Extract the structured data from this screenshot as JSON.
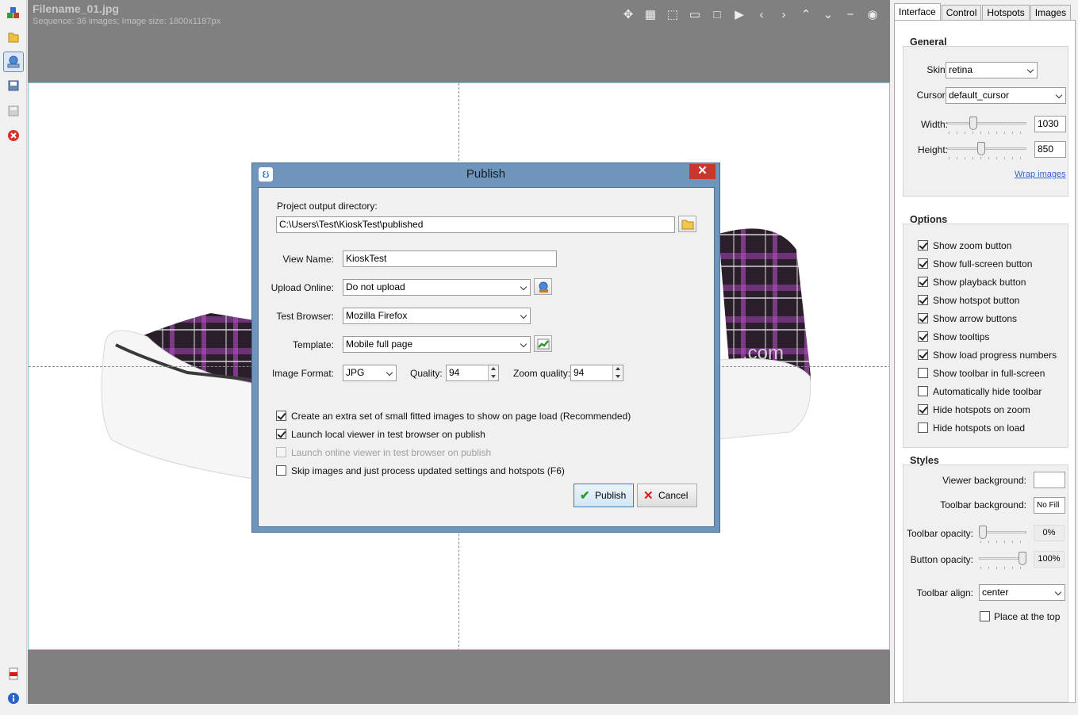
{
  "viewer": {
    "title": "Filename_01.jpg",
    "subtitle": "Sequence: 36 images; Image size: 1800x1187px",
    "watermark": ".com",
    "toolbar_icons": [
      "move-icon",
      "grid-icon",
      "select-icon",
      "fit-icon",
      "fullscreen-icon",
      "play-icon",
      "arrow-left-icon",
      "arrow-right-icon",
      "arrow-up-icon",
      "arrow-down-icon",
      "minus-icon",
      "target-icon"
    ]
  },
  "left_toolbar": {
    "icons": [
      "puzzle-icon",
      "folder-icon",
      "publish-icon",
      "save-image-icon",
      "save-icon",
      "close-red-icon",
      "pdf-icon",
      "info-icon"
    ]
  },
  "panel": {
    "tabs": [
      "Interface",
      "Control",
      "Hotspots",
      "Images"
    ],
    "general": {
      "title": "General",
      "skin_label": "Skin:",
      "skin_value": "retina",
      "cursor_label": "Cursor:",
      "cursor_value": "default_cursor",
      "width_label": "Width:",
      "width_value": "1030",
      "height_label": "Height:",
      "height_value": "850",
      "wrap_link": "Wrap images"
    },
    "options": {
      "title": "Options",
      "items": [
        {
          "label": "Show zoom button",
          "checked": true
        },
        {
          "label": "Show full-screen button",
          "checked": true
        },
        {
          "label": "Show playback button",
          "checked": true
        },
        {
          "label": "Show hotspot button",
          "checked": true
        },
        {
          "label": "Show arrow buttons",
          "checked": true
        },
        {
          "label": "Show tooltips",
          "checked": true
        },
        {
          "label": "Show load progress numbers",
          "checked": true
        },
        {
          "label": "Show toolbar in full-screen",
          "checked": false
        },
        {
          "label": "Automatically hide toolbar",
          "checked": false
        },
        {
          "label": "Hide hotspots on zoom",
          "checked": true
        },
        {
          "label": "Hide hotspots on load",
          "checked": false
        }
      ]
    },
    "styles": {
      "title": "Styles",
      "viewer_bg_label": "Viewer background:",
      "toolbar_bg_label": "Toolbar background:",
      "toolbar_bg_value": "No Fill",
      "toolbar_opacity_label": "Toolbar opacity:",
      "toolbar_opacity_value": "0%",
      "button_opacity_label": "Button opacity:",
      "button_opacity_value": "100%",
      "toolbar_align_label": "Toolbar align:",
      "toolbar_align_value": "center",
      "place_top_label": "Place at the top"
    }
  },
  "dialog": {
    "title": "Publish",
    "output_dir_label": "Project output directory:",
    "output_dir_value": "C:\\Users\\Test\\KioskTest\\published",
    "view_name_label": "View Name:",
    "view_name_value": "KioskTest",
    "upload_label": "Upload Online:",
    "upload_value": "Do not upload",
    "browser_label": "Test Browser:",
    "browser_value": "Mozilla Firefox",
    "template_label": "Template:",
    "template_value": "Mobile full page",
    "format_label": "Image Format:",
    "format_value": "JPG",
    "quality_label": "Quality:",
    "quality_value": "94",
    "zoom_quality_label": "Zoom quality:",
    "zoom_quality_value": "94",
    "checks": [
      {
        "label": "Create an extra set of small fitted images to show on page load (Recommended)",
        "checked": true,
        "disabled": false
      },
      {
        "label": "Launch local viewer in test browser on publish",
        "checked": true,
        "disabled": false
      },
      {
        "label": "Launch online viewer in test browser on publish",
        "checked": false,
        "disabled": true
      },
      {
        "label": "Skip images and just process updated settings and hotspots (F6)",
        "checked": false,
        "disabled": false
      }
    ],
    "publish_label": "Publish",
    "cancel_label": "Cancel"
  }
}
